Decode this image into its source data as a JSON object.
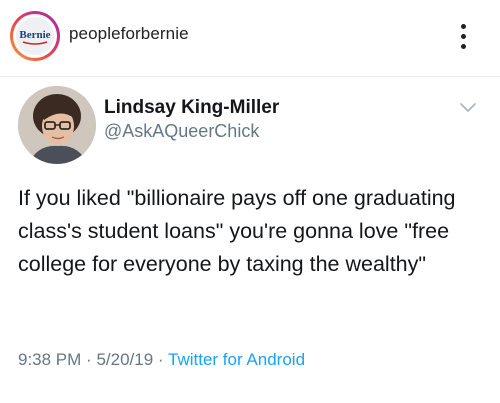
{
  "instagram": {
    "username": "peopleforbernie",
    "avatar_text": "Bernie",
    "more_icon": "more-vertical-icon"
  },
  "tweet": {
    "author_name": "Lindsay King-Miller",
    "author_handle": "@AskAQueerChick",
    "text": "If you liked \"billionaire pays off one graduating class's student loans\" you're gonna love \"free college for everyone by taxing the wealthy\"",
    "time": "9:38 PM",
    "date": "5/20/19",
    "separator": "·",
    "source": "Twitter for Android",
    "chevron_icon": "chevron-down-icon"
  },
  "colors": {
    "text_primary": "#14171a",
    "text_secondary": "#657786",
    "link": "#1da1f2",
    "bernie_blue": "#1f3b8f",
    "bernie_red": "#d2232a"
  }
}
